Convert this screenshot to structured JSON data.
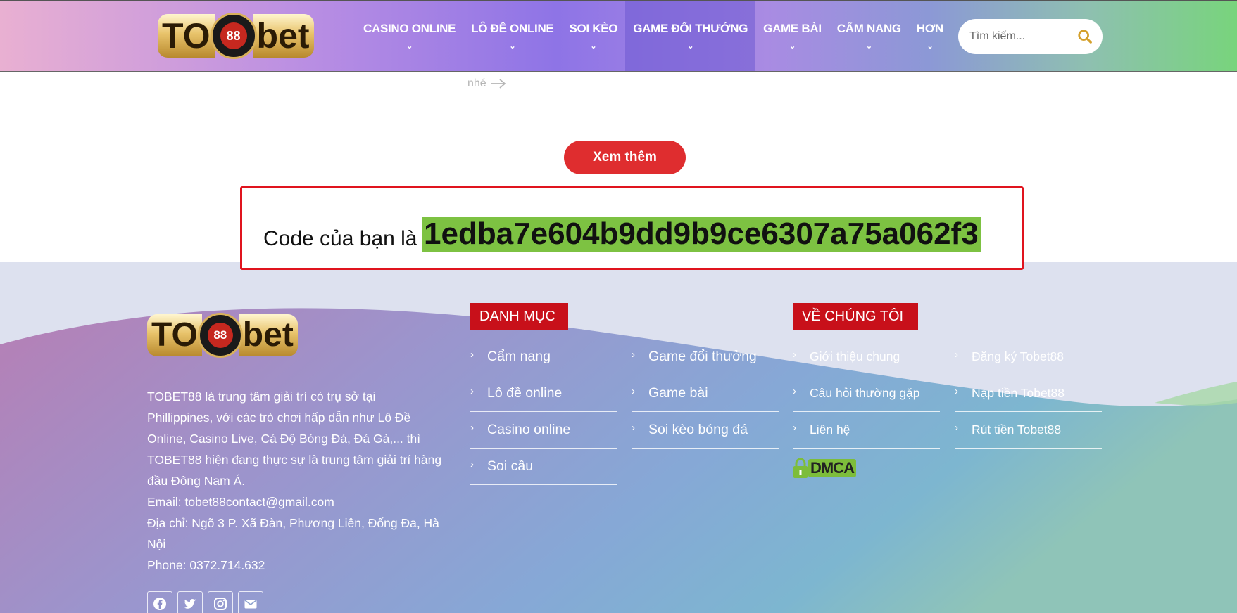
{
  "header": {
    "logo": {
      "left": "TO",
      "chip": "88",
      "right": "bet"
    },
    "nav": [
      {
        "label": "CASINO ONLINE",
        "active": false
      },
      {
        "label": "LÔ ĐỀ ONLINE",
        "active": false
      },
      {
        "label": "SOI KÈO",
        "active": false
      },
      {
        "label": "GAME ĐỔI THƯỞNG",
        "active": true
      },
      {
        "label": "GAME BÀI",
        "active": false
      },
      {
        "label": "CẨM NANG",
        "active": false
      },
      {
        "label": "HƠN",
        "active": false
      }
    ],
    "search": {
      "placeholder": "Tìm kiếm..."
    }
  },
  "main": {
    "read_more_text": "nhé",
    "see_more_button": "Xem thêm"
  },
  "code_box": {
    "label": "Code của bạn là",
    "code": "1edba7e604b9dd9b9ce6307a75a062f3"
  },
  "footer": {
    "logo": {
      "left": "TO",
      "chip": "88",
      "right": "bet"
    },
    "about": [
      "TOBET88 là trung tâm giải trí có trụ sở tại Phillippines, với các trò chơi hấp dẫn như Lô Đề Online, Casino Live, Cá Độ Bóng Đá, Đá Gà,... thì TOBET88 hiện đang thực sự là trung tâm giải trí hàng đầu Đông Nam Á.",
      "Email: tobet88contact@gmail.com",
      "Địa chỉ: Ngõ 3 P. Xã Đàn, Phương Liên, Đống Đa, Hà Nội",
      "Phone: 0372.714.632"
    ],
    "categories_title": "DANH MỤC",
    "categories_col1": [
      "Cẩm nang",
      "Lô đề online",
      "Casino online",
      "Soi cầu"
    ],
    "categories_col2": [
      "Game đổi thưởng",
      "Game bài",
      "Soi kèo bóng đá"
    ],
    "about_us_title": "VỀ CHÚNG TÔI",
    "about_us_col1": [
      "Giới thiệu chung",
      "Câu hỏi thường gặp",
      "Liên hệ"
    ],
    "about_us_col2": [
      "Đăng ký Tobet88",
      "Nạp tiền Tobet88",
      "Rút tiền Tobet88"
    ],
    "dmca_label": "DMCA",
    "socials": [
      "facebook-icon",
      "twitter-icon",
      "instagram-icon",
      "email-icon"
    ]
  },
  "colors": {
    "accent_red": "#c8101a",
    "button_red": "#df2d2f",
    "code_highlight": "#7dc242"
  }
}
